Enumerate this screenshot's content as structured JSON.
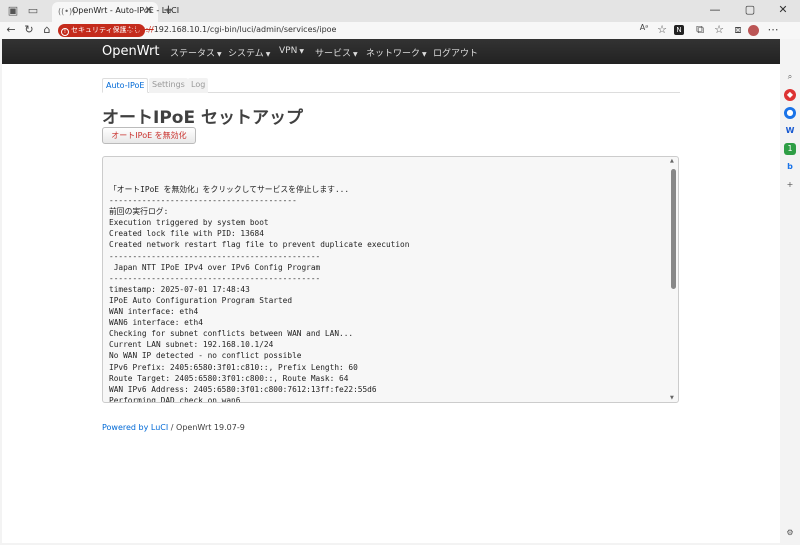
{
  "browser": {
    "tab_title": "OpenWrt - Auto-IPoE - LuCI",
    "security_badge": "セキュリティ保護なし",
    "url_scheme": "https://",
    "url_rest": "192.168.10.1/cgi-bin/luci/admin/services/ipoe"
  },
  "navbar": {
    "brand": "OpenWrt",
    "menu": [
      "ステータス",
      "システム",
      "VPN",
      "サービス",
      "ネットワーク",
      "ログアウト"
    ]
  },
  "tabs": [
    "Auto-IPoE",
    "Settings",
    "Log"
  ],
  "page_title": "オートIPoE セットアップ",
  "stop_button": "オートIPoE を無効化",
  "log_lines": [
    "「オートIPoE を無効化」をクリックしてサービスを停止します...",
    "----------------------------------------",
    "前回の実行ログ:",
    "Execution triggered by system boot",
    "Created lock file with PID: 13684",
    "Created network restart flag file to prevent duplicate execution",
    "---------------------------------------------",
    " Japan NTT IPoE IPv4 over IPv6 Config Program",
    "---------------------------------------------",
    "timestamp: 2025-07-01 17:48:43",
    "IPoE Auto Configuration Program Started",
    "WAN interface: eth4",
    "WAN6 interface: eth4",
    "Checking for subnet conflicts between WAN and LAN...",
    "Current LAN subnet: 192.168.10.1/24",
    "No WAN IP detected - no conflict possible",
    "IPv6 Prefix: 2405:6580:3f01:c810::, Prefix Length: 60",
    "Route Target: 2405:6580:3f01:c800::, Route Mask: 64",
    "WAN IPv6 Address: 2405:6580:3f01:c800:7612:13ff:fe22:55d6",
    "Performing DAD check on wan6"
  ],
  "footer": {
    "link": "Powered by LuCI",
    "text": " / OpenWrt 19.07-9"
  }
}
